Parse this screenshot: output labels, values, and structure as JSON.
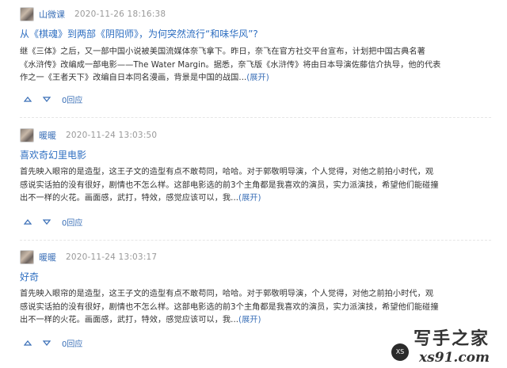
{
  "posts": [
    {
      "user": "山微课",
      "time": "2020-11-26 18:16:38",
      "title": "从《棋魂》到两部《阴阳师》，为何突然流行“和味华风”?",
      "body_lines": [
        "继《三体》之后，又一部中国小说被美国流媒体奈飞拿下。昨日，奈飞在官方社交平台宣布，计划把中国古典名著",
        "《水浒传》改编成一部电影——The Water Margin。据悉，奈飞版《水浒传》将由日本导演佐藤信介执导，他的代表",
        "作之一《王者天下》改编自日本同名漫画，背景是中国的战国..."
      ],
      "expand": "(展开)",
      "replies": "0回应"
    },
    {
      "user": "暖暖",
      "time": "2020-11-24 13:03:50",
      "title": "喜欢奇幻里电影",
      "body_lines": [
        "首先映入眼帘的是造型，这王子文的造型有点不敢苟同，哈哈。对于郭敬明导演，个人觉得，对他之前拍小时代，观",
        "感说实话拍的没有很好，剧情也不怎么样。这部电影选的前3个主角都是我喜欢的演员，实力派演技，希望他们能碰撞",
        "出不一样的火花。画面感，武打，特效，感觉应该可以，我..."
      ],
      "expand": "(展开)",
      "replies": "0回应"
    },
    {
      "user": "暖暖",
      "time": "2020-11-24 13:03:17",
      "title": "好奇",
      "body_lines": [
        "首先映入眼帘的是造型，这王子文的造型有点不敢苟同，哈哈。对于郭敬明导演，个人觉得，对他之前拍小时代，观",
        "感说实话拍的没有很好，剧情也不怎么样。这部电影选的前3个主角都是我喜欢的演员，实力派演技，希望他们能碰撞",
        "出不一样的火花。画面感，武打，特效，感觉应该可以，我..."
      ],
      "expand": "(展开)",
      "replies": "0回应"
    }
  ],
  "watermark": {
    "cn": "写手之家",
    "url": "xs91.com",
    "mark": "XS"
  },
  "colors": {
    "link": "#2f6fc1",
    "text": "#333333",
    "muted": "#999999"
  },
  "icons": {
    "upvote": "triangle-up-icon",
    "downvote": "triangle-down-icon",
    "avatar": "user-avatar"
  }
}
